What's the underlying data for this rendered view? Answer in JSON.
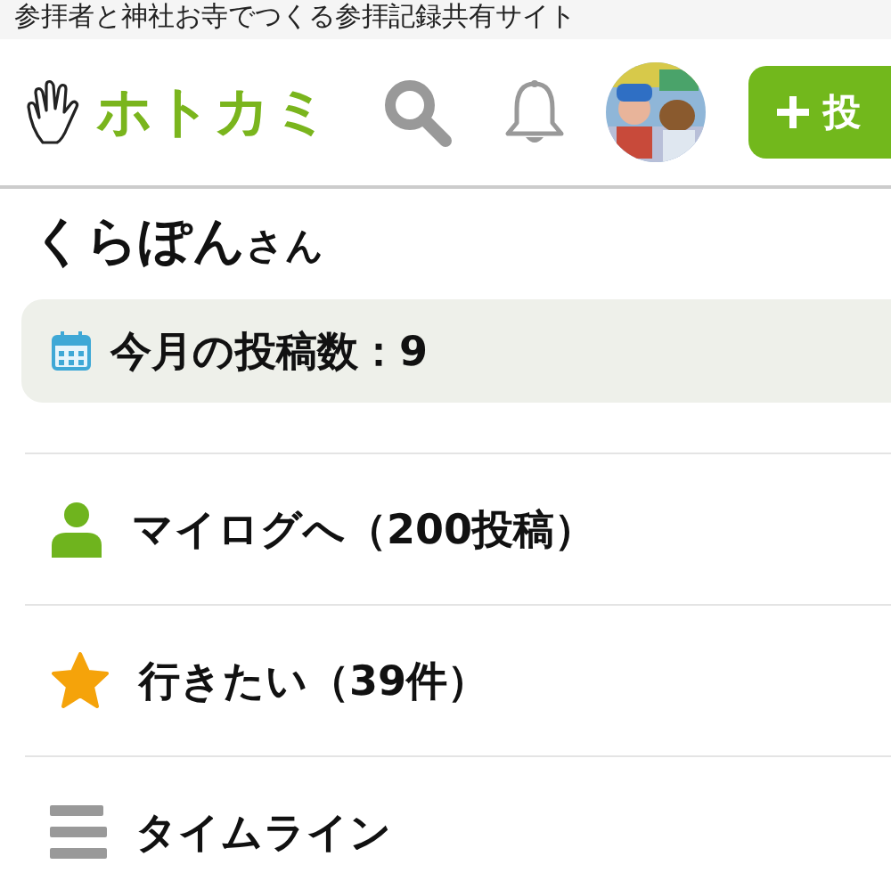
{
  "tagline": "参拝者と神社お寺でつくる参拝記録共有サイト",
  "header": {
    "logo": "ホトカミ",
    "post_button": "投"
  },
  "user": {
    "name": "くらぽん",
    "suffix": "さん"
  },
  "stats": {
    "text": "今月の投稿数：9"
  },
  "menu": [
    {
      "kind": "person",
      "label": "マイログへ（200投稿）"
    },
    {
      "kind": "star",
      "label": "行きたい（39件）"
    },
    {
      "kind": "list",
      "label": "タイムライン"
    }
  ]
}
